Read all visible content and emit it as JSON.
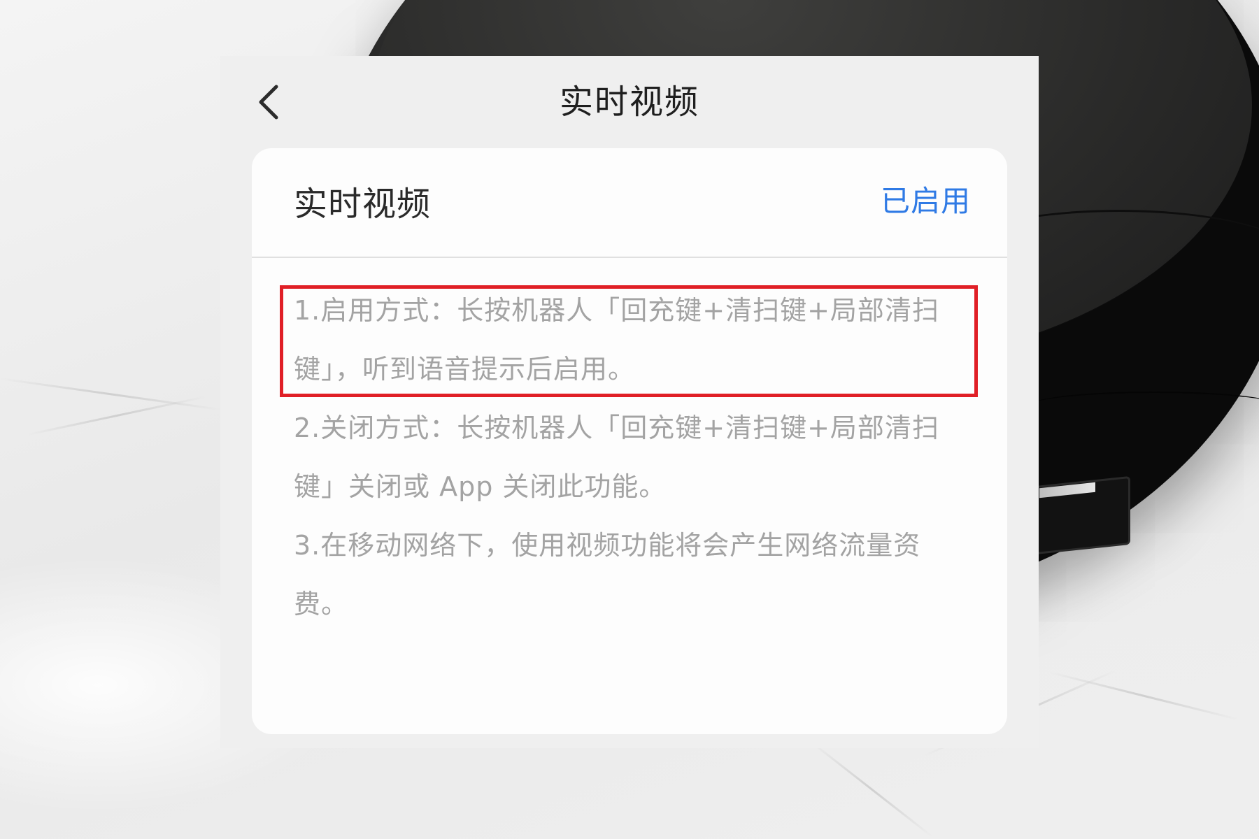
{
  "header": {
    "title": "实时视频",
    "back_icon": "chevron-left-icon"
  },
  "setting": {
    "label": "实时视频",
    "status": "已启用",
    "status_color": "#2f7ae5"
  },
  "instructions": [
    "1.启用方式：长按机器人「回充键+清扫键+局部清扫键」，听到语音提示后启用。",
    "2.关闭方式：长按机器人「回充键+清扫键+局部清扫键」关闭或 App 关闭此功能。",
    "3.在移动网络下，使用视频功能将会产生网络流量资费。"
  ],
  "highlight": {
    "target": "instructions.0",
    "color": "#e01f26"
  }
}
